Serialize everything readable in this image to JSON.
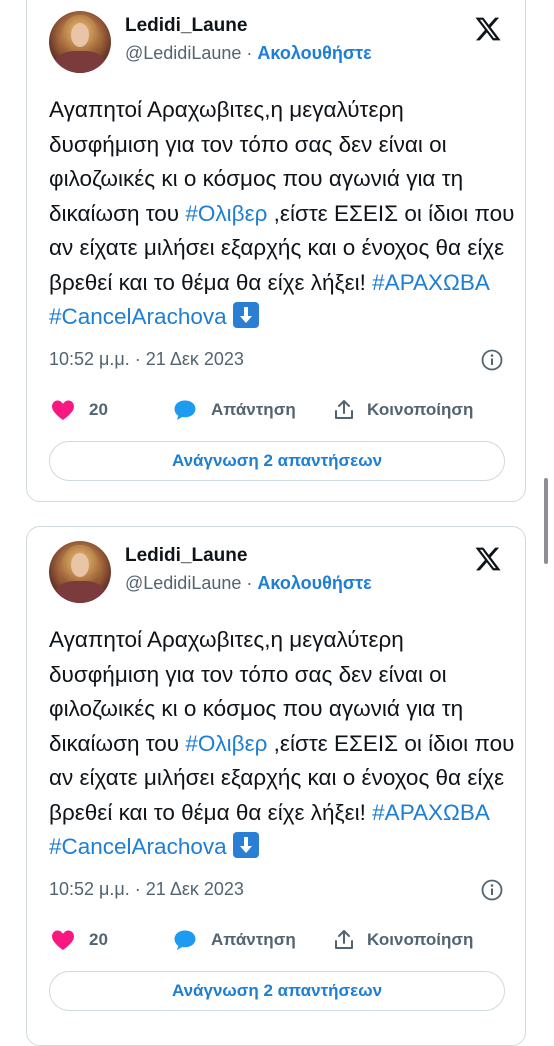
{
  "tweets": [
    {
      "author_name": "Ledidi_Laune",
      "handle": "@LedidiLaune",
      "separator": "·",
      "follow_label": "Ακολουθήστε",
      "text_parts": [
        "Αγαπητοί Αραχωβιτες,η μεγαλύτερη δυσφήμιση για τον τόπο σας δεν είναι οι φιλοζωικές κι ο κόσμος που αγωνιά για τη δικαίωση του ",
        "#Ολιβερ",
        " ,είστε ΕΣΕΙΣ οι ίδιοι που αν είχατε μιλήσει εξαρχής και ο ένοχος θα είχε βρεθεί και το θέμα θα είχε λήξει! ",
        "#ΑΡΑΧΩΒΑ",
        "#CancelArachova"
      ],
      "timestamp": "10:52 μ.μ. · 21 Δεκ 2023",
      "likes": "20",
      "reply_label": "Απάντηση",
      "share_label": "Κοινοποίηση",
      "read_replies_label": "Ανάγνωση 2 απαντήσεων"
    },
    {
      "author_name": "Ledidi_Laune",
      "handle": "@LedidiLaune",
      "separator": "·",
      "follow_label": "Ακολουθήστε",
      "text_parts": [
        "Αγαπητοί Αραχωβιτες,η μεγαλύτερη δυσφήμιση για τον τόπο σας δεν είναι οι φιλοζωικές κι ο κόσμος που αγωνιά για τη δικαίωση του ",
        "#Ολιβερ",
        " ,είστε ΕΣΕΙΣ οι ίδιοι που αν είχατε μιλήσει εξαρχής και ο ένοχος θα είχε βρεθεί και το θέμα θα είχε λήξει! ",
        "#ΑΡΑΧΩΒΑ",
        "#CancelArachova"
      ],
      "timestamp": "10:52 μ.μ. · 21 Δεκ 2023",
      "likes": "20",
      "reply_label": "Απάντηση",
      "share_label": "Κοινοποίηση",
      "read_replies_label": "Ανάγνωση 2 απαντήσεων"
    }
  ],
  "icons": {
    "brand": "x-logo-icon",
    "like": "heart-icon",
    "reply": "speech-bubble-icon",
    "share": "share-upload-icon",
    "info": "info-icon",
    "emoji": "down-arrow-emoji-icon"
  },
  "colors": {
    "link": "#1d7ed6",
    "heart": "#f91880",
    "reply_bubble": "#1d9bf0",
    "border": "#cfd9de",
    "muted": "#536471",
    "emoji_bg": "#2a7fd4"
  }
}
